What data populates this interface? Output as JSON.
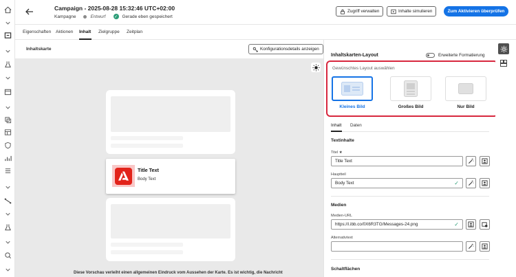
{
  "header": {
    "title": "Campaign - 2025-08-28 15:32:46 UTC+02:00",
    "type": "Kampagne",
    "status": "Entwurf",
    "saved": "Gerade eben gespeichert",
    "manage_access": "Zugriff verwalten",
    "simulate": "Inhalte simulieren",
    "activate": "Zum Aktivieren überprüfen"
  },
  "tabs": [
    "Eigenschaften",
    "Aktionen",
    "Inhalt",
    "Zielgruppe",
    "Zeitplan"
  ],
  "active_tab": "Inhalt",
  "preview": {
    "label": "Inhaltskarte",
    "config_button": "Konfigurationsdetails anzeigen",
    "card_title": "Title Text",
    "card_body": "Body Text",
    "note": "Diese Vorschau verleiht einen allgemeinen Eindruck vom Aussehen der Karte. Es ist wichtig, die Nachricht"
  },
  "panel": {
    "title": "Inhaltskarten-Layout",
    "advanced_toggle": "Erweiterte Formatierung",
    "layout_label": "Gewünschtes Layout auswählen",
    "layouts": [
      "Kleines Bild",
      "Großes Bild",
      "Nur Bild"
    ],
    "selected_layout": "Kleines Bild",
    "sub_tabs": [
      "Inhalt",
      "Daten"
    ],
    "text_section": "Textinhalte",
    "title_label": "Titel",
    "required_mark": "★",
    "title_value": "Title Text",
    "body_label": "Hauptteil",
    "body_value": "Body Text",
    "media_section": "Medien",
    "media_url_label": "Medien-URL",
    "media_url_value": "https://i.ibb.co/0X6R3TG/Messages-24.png",
    "alt_label": "Alternativtext",
    "alt_value": "",
    "buttons_section": "Schaltflächen"
  },
  "colors": {
    "accent": "#1473e6",
    "highlight": "#d7263d",
    "success": "#2d9d78"
  }
}
